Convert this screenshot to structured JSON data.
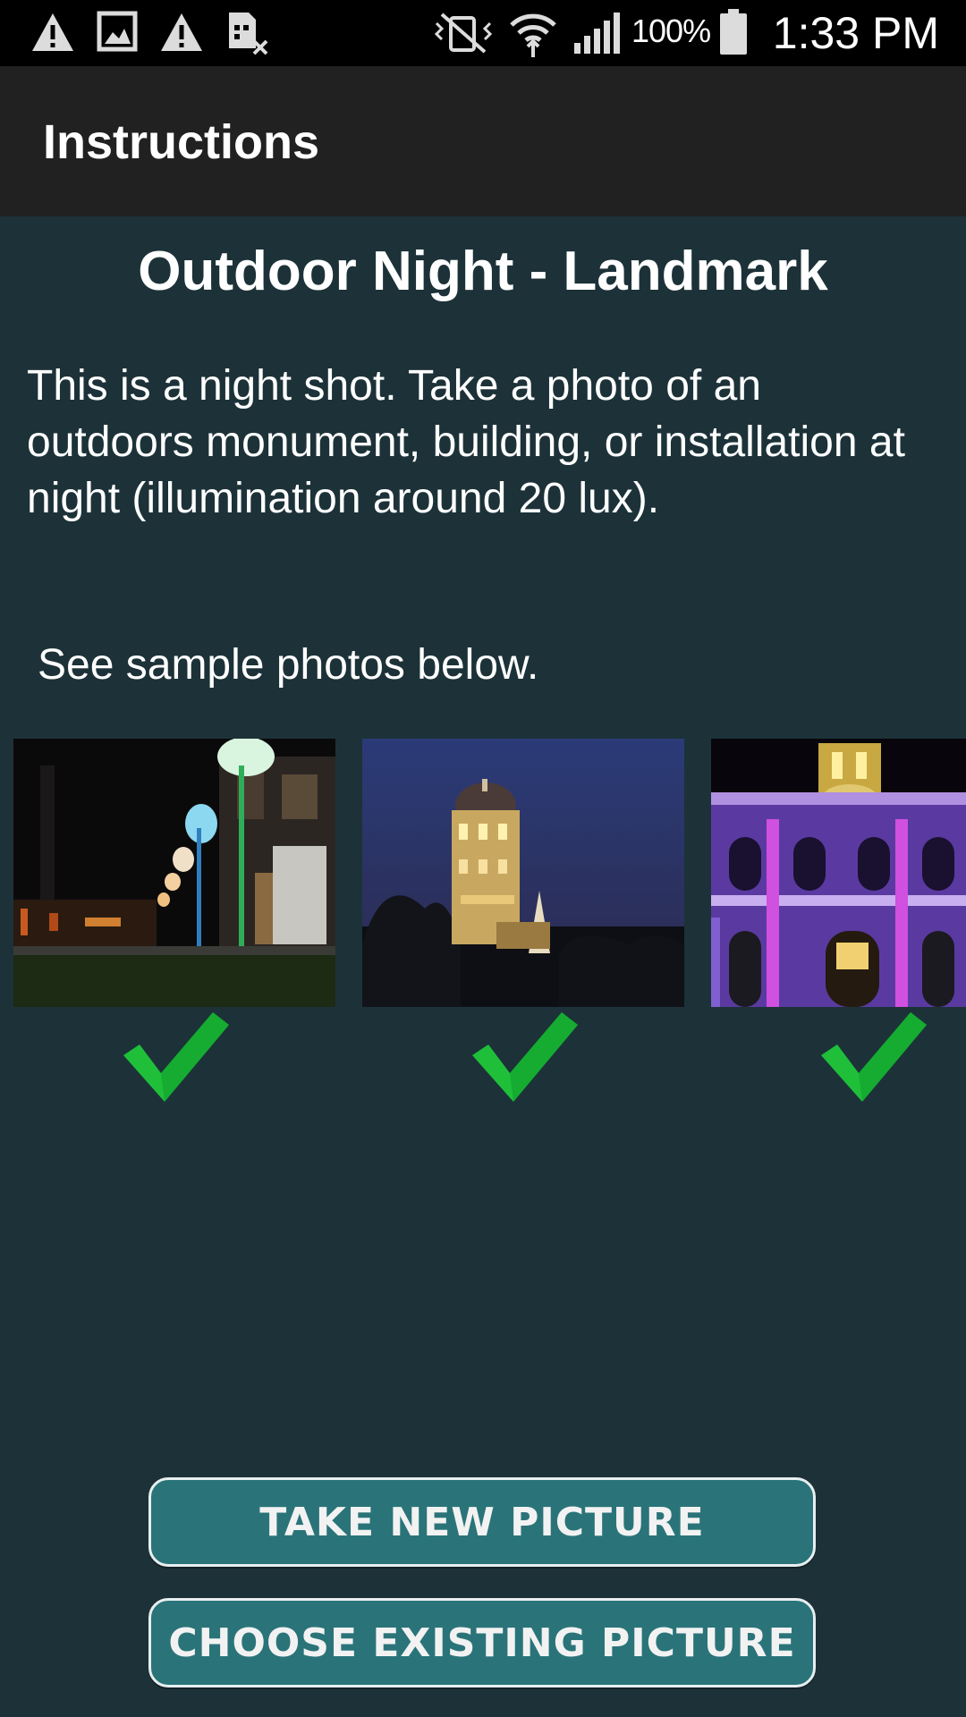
{
  "status_bar": {
    "battery": "100%",
    "time": "1:33 PM",
    "left_icons": [
      "warning-icon",
      "image-icon",
      "warning-icon",
      "sim-card-off-icon"
    ],
    "right_icons": [
      "vibrate-mute-icon",
      "wifi-icon",
      "signal-icon",
      "battery-icon"
    ]
  },
  "action_bar": {
    "title": "Instructions"
  },
  "content": {
    "heading": "Outdoor Night - Landmark",
    "description": "This is a night shot. Take a photo of an outdoors monument, building, or installation at night (illumination around 20 lux).",
    "see_samples": "See sample photos below."
  },
  "samples": [
    {
      "name": "street at night with lamps",
      "status": "check-icon"
    },
    {
      "name": "illuminated tower at dusk",
      "status": "check-icon"
    },
    {
      "name": "purple-lit building facade",
      "status": "check-icon"
    }
  ],
  "buttons": {
    "take_new": "TAKE NEW PICTURE",
    "choose_existing": "CHOOSE EXISTING PICTURE"
  },
  "colors": {
    "background": "#1c3238",
    "action_bar": "#212121",
    "button_fill": "#2a7479",
    "check_green": "#1fbf3a"
  }
}
